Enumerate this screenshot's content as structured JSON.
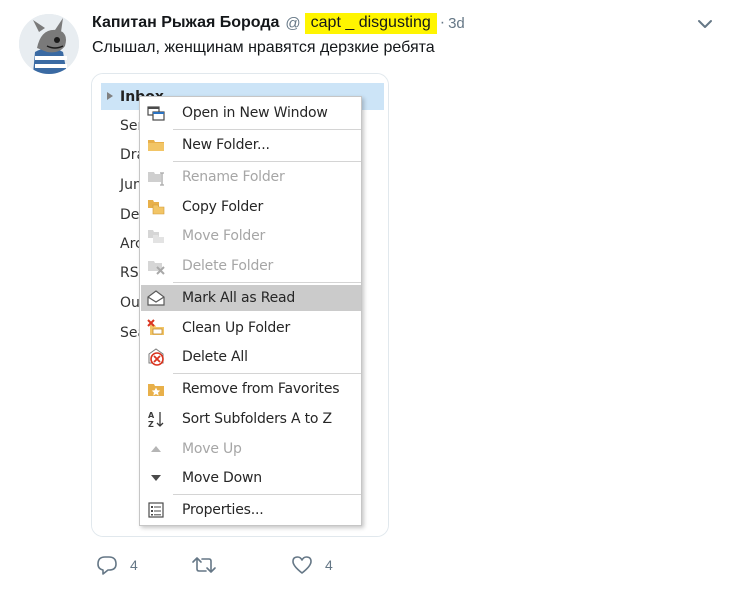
{
  "tweet": {
    "display_name": "Капитан Рыжая Борода",
    "at_sign": "@",
    "handle": "capt _ disgusting",
    "separator": "·",
    "time": "3d",
    "text": "Слышал, женщинам нравятся дерзкие ребята"
  },
  "outlook": {
    "inbox_label": "Inbox",
    "folders": [
      "Ser",
      "Dra",
      "Jun",
      "De",
      "Arc",
      "RSS",
      "Ou",
      "Sea"
    ],
    "highlight_color": "#cce4f7",
    "context_menu": {
      "items": [
        {
          "label": "Open in New Window",
          "icon": "new-window-icon",
          "disabled": false
        },
        {
          "label": "New Folder...",
          "icon": "folder-icon",
          "disabled": false
        },
        {
          "label": "Rename Folder",
          "icon": "rename-folder-icon",
          "disabled": true
        },
        {
          "label": "Copy Folder",
          "icon": "copy-folder-icon",
          "disabled": false
        },
        {
          "label": "Move Folder",
          "icon": "move-folder-icon",
          "disabled": true
        },
        {
          "label": "Delete Folder",
          "icon": "delete-folder-icon",
          "disabled": true
        },
        {
          "label": "Mark All as Read",
          "icon": "envelope-open-icon",
          "disabled": false,
          "highlighted": true
        },
        {
          "label": "Clean Up Folder",
          "icon": "clean-up-icon",
          "disabled": false
        },
        {
          "label": "Delete All",
          "icon": "delete-all-icon",
          "disabled": false
        },
        {
          "label": "Remove from Favorites",
          "icon": "favorites-icon",
          "disabled": false
        },
        {
          "label": "Sort Subfolders A to Z",
          "icon": "sort-az-icon",
          "disabled": false
        },
        {
          "label": "Move Up",
          "icon": "triangle-up-icon",
          "disabled": true
        },
        {
          "label": "Move Down",
          "icon": "triangle-down-icon",
          "disabled": false
        },
        {
          "label": "Properties...",
          "icon": "properties-icon",
          "disabled": false
        }
      ]
    }
  },
  "actions": {
    "reply_count": "4",
    "like_count": "4"
  },
  "colors": {
    "handle_highlight": "#fff500",
    "menu_hover": "#cbcbcb",
    "muted_text": "#657786"
  }
}
